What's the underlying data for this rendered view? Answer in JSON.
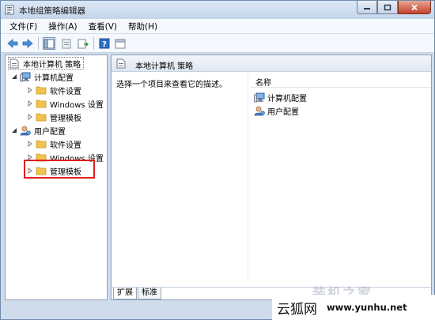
{
  "window": {
    "title": "本地组策略编辑器",
    "icon": "policy-editor-icon"
  },
  "menu": {
    "items": [
      "文件(F)",
      "操作(A)",
      "查看(V)",
      "帮助(H)"
    ]
  },
  "toolbar": {
    "buttons": [
      "back-arrow-icon",
      "forward-arrow-icon",
      "show-hide-tree-icon",
      "properties-icon",
      "export-list-icon",
      "help-icon",
      "filter-view-icon"
    ]
  },
  "tree": {
    "root": "本地计算机 策略",
    "computer_config": {
      "label": "计算机配置",
      "children": [
        "软件设置",
        "Windows 设置",
        "管理模板"
      ]
    },
    "user_config": {
      "label": "用户配置",
      "children": [
        "软件设置",
        "Windows 设置",
        "管理模板"
      ]
    }
  },
  "details": {
    "header_title": "本地计算机 策略",
    "description": "选择一个项目来查看它的描述。",
    "column_name": "名称",
    "items": [
      "计算机配置",
      "用户配置"
    ]
  },
  "tabs": [
    "扩展",
    "标准"
  ],
  "watermark": {
    "overlay": "装机之家",
    "brand": "云狐网",
    "url": "www.yunhu.net"
  },
  "colors": {
    "accent": "#1f63b8",
    "folder": "#f1c24e",
    "highlight": "#e01e1e"
  }
}
